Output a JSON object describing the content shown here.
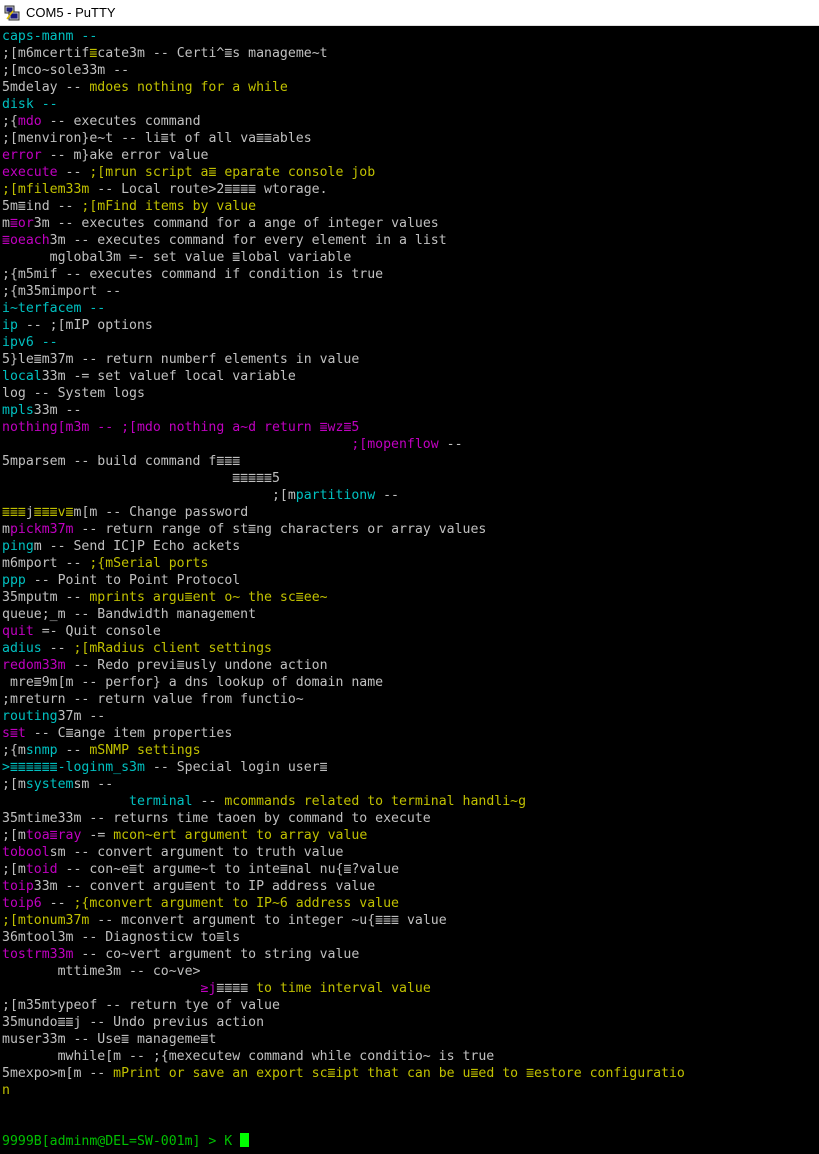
{
  "window": {
    "title": "COM5 - PuTTY",
    "icon": "putty-terminal-icon"
  },
  "colors": {
    "gray": "#c0c0c0",
    "cyan": "#00c0c0",
    "yellow": "#c0c000",
    "magenta": "#c000c0",
    "green": "#00c000",
    "cursor": "#00ff00"
  },
  "lines": [
    [
      [
        "cyan",
        "caps-manm --"
      ]
    ],
    [
      [
        "gray",
        ";[m6mcertif"
      ],
      [
        "yellow",
        "≣"
      ],
      [
        "gray",
        "cate3m -- Certi^"
      ],
      [
        "gray",
        "≣"
      ],
      [
        "gray",
        "s manageme~t"
      ]
    ],
    [
      [
        "gray",
        ";[mco~sole33m --"
      ]
    ],
    [
      [
        "gray",
        "5mdelay -- "
      ],
      [
        "yellow",
        "mdoes nothing for a while"
      ]
    ],
    [
      [
        "cyan",
        "disk --"
      ]
    ],
    [
      [
        "gray",
        ";{"
      ],
      [
        "magenta",
        "mdo"
      ],
      [
        "gray",
        " -- executes command"
      ]
    ],
    [
      [
        "gray",
        ";[menviron}e~t -- li"
      ],
      [
        "gray",
        "≣"
      ],
      [
        "gray",
        "t of all va"
      ],
      [
        "gray",
        "≣≣"
      ],
      [
        "gray",
        "ables"
      ]
    ],
    [
      [
        "magenta",
        "error"
      ],
      [
        "gray",
        " -- m}ake error value"
      ]
    ],
    [
      [
        "magenta",
        "execute"
      ],
      [
        "gray",
        " -- "
      ],
      [
        "yellow",
        ";[mrun script a"
      ],
      [
        "yellow",
        "≣"
      ],
      [
        "yellow",
        " eparate console job"
      ]
    ],
    [
      [
        "yellow",
        ";[mfilem33m"
      ],
      [
        "gray",
        " -- Local route>2"
      ],
      [
        "gray",
        "≣≣≣≣"
      ],
      [
        "gray",
        " wtorage."
      ]
    ],
    [
      [
        "gray",
        "5m"
      ],
      [
        "gray",
        "≣"
      ],
      [
        "gray",
        "ind -- "
      ],
      [
        "yellow",
        ";[mFind items by value"
      ]
    ],
    [
      [
        "gray",
        "m"
      ],
      [
        "magenta",
        "≣"
      ],
      [
        "magenta",
        "or"
      ],
      [
        "gray",
        "3m -- executes command for a ange of integer values"
      ]
    ],
    [
      [
        "magenta",
        "≣"
      ],
      [
        "magenta",
        "oeach"
      ],
      [
        "gray",
        "3m -- executes command for every element in a list"
      ]
    ],
    [
      [
        "gray",
        "      mglobal3m =- set value "
      ],
      [
        "gray",
        "≣"
      ],
      [
        "gray",
        "lobal variable"
      ]
    ],
    [
      [
        "gray",
        ";{m5mif -- executes command if condition is true"
      ]
    ],
    [
      [
        "gray",
        ";{m35mimport --"
      ]
    ],
    [
      [
        "cyan",
        "i~terfacem --"
      ]
    ],
    [
      [
        "cyan",
        "ip"
      ],
      [
        "gray",
        " -- ;[mIP options"
      ]
    ],
    [
      [
        "cyan",
        "ipv6 --"
      ]
    ],
    [
      [
        "gray",
        "5}le"
      ],
      [
        "gray",
        "≣"
      ],
      [
        "gray",
        "m37m -- return numberf elements in value"
      ]
    ],
    [
      [
        "cyan",
        "local"
      ],
      [
        "gray",
        "33m -= set valuef local variable"
      ]
    ],
    [
      [
        "gray",
        "log -- System logs"
      ]
    ],
    [
      [
        "cyan",
        "mpls"
      ],
      [
        "gray",
        "33m --"
      ]
    ],
    [
      [
        "magenta",
        "nothing[m3m -- ;[mdo nothing a~d return "
      ],
      [
        "magenta",
        "≣"
      ],
      [
        "magenta",
        "wz"
      ],
      [
        "magenta",
        "≣"
      ],
      [
        "magenta",
        "5"
      ]
    ],
    [
      [
        "magenta",
        "                                            ;[mopenflow"
      ],
      [
        "gray",
        " --"
      ]
    ],
    [
      [
        "gray",
        "5mparsem -- build command f"
      ],
      [
        "gray",
        "≣≣≣"
      ]
    ],
    [
      [
        "gray",
        "                             ≣≣≣≣≣5"
      ]
    ],
    [
      [
        "gray",
        "                                  ;[m"
      ],
      [
        "cyan",
        "partitionw"
      ],
      [
        "gray",
        " --"
      ]
    ],
    [
      [
        "yellow",
        "≣≣≣"
      ],
      [
        "gray",
        "j"
      ],
      [
        "yellow",
        "≣≣≣"
      ],
      [
        "yellow",
        "v≣"
      ],
      [
        "gray",
        "m[m -- Change password"
      ]
    ],
    [
      [
        "gray",
        "m"
      ],
      [
        "magenta",
        "pickm37m"
      ],
      [
        "gray",
        " -- return range of st"
      ],
      [
        "gray",
        "≣"
      ],
      [
        "gray",
        "ng characters or array values"
      ]
    ],
    [
      [
        "cyan",
        "ping"
      ],
      [
        "gray",
        "m -- Send IC]P Echo ackets"
      ]
    ],
    [
      [
        "gray",
        "m6mport -- "
      ],
      [
        "yellow",
        ";{mSerial ports"
      ]
    ],
    [
      [
        "cyan",
        "ppp"
      ],
      [
        "gray",
        " -- Point to Point Protocol"
      ]
    ],
    [
      [
        "gray",
        "35mputm -- "
      ],
      [
        "yellow",
        "mprints argu"
      ],
      [
        "yellow",
        "≣"
      ],
      [
        "yellow",
        "ent o~ the sc"
      ],
      [
        "yellow",
        "≣"
      ],
      [
        "yellow",
        "ee~"
      ]
    ],
    [
      [
        "gray",
        "queue;_m -- Bandwidth management"
      ]
    ],
    [
      [
        "magenta",
        "quit"
      ],
      [
        "gray",
        " =- Quit console"
      ]
    ],
    [
      [
        "cyan",
        "adius"
      ],
      [
        "gray",
        " -- "
      ],
      [
        "yellow",
        ";[mRadius client settings"
      ]
    ],
    [
      [
        "magenta",
        "redom33m"
      ],
      [
        "gray",
        " -- Redo previ"
      ],
      [
        "gray",
        "≣"
      ],
      [
        "gray",
        "usly undone action"
      ]
    ],
    [
      [
        "gray",
        " mre"
      ],
      [
        "gray",
        "≣"
      ],
      [
        "gray",
        "9m[m -- perfor} a dns lookup of domain name"
      ]
    ],
    [
      [
        "gray",
        ";mreturn -- return value from functio~"
      ]
    ],
    [
      [
        "cyan",
        "routing"
      ],
      [
        "gray",
        "37m --"
      ]
    ],
    [
      [
        "magenta",
        "s"
      ],
      [
        "magenta",
        "≣"
      ],
      [
        "magenta",
        "t"
      ],
      [
        "gray",
        " -- C"
      ],
      [
        "gray",
        "≣"
      ],
      [
        "gray",
        "ange item properties"
      ]
    ],
    [
      [
        "gray",
        ";{m"
      ],
      [
        "cyan",
        "snmp"
      ],
      [
        "gray",
        " -- "
      ],
      [
        "yellow",
        "mSNMP settings"
      ]
    ],
    [
      [
        "cyan",
        ">"
      ],
      [
        "cyan",
        "≣≣≣≣≣≣"
      ],
      [
        "cyan",
        "-loginm_s3m"
      ],
      [
        "gray",
        " -- Special login user"
      ],
      [
        "gray",
        "≣"
      ]
    ],
    [
      [
        "gray",
        ";[m"
      ],
      [
        "cyan",
        "system"
      ],
      [
        "gray",
        "sm --"
      ]
    ],
    [
      [
        "cyan",
        "                terminal"
      ],
      [
        "gray",
        " -- "
      ],
      [
        "yellow",
        "mcommands related to terminal handli~g"
      ]
    ],
    [
      [
        "gray",
        "35mtime33m -- returns time taoen by command to execute"
      ]
    ],
    [
      [
        "gray",
        ";[m"
      ],
      [
        "magenta",
        "toa"
      ],
      [
        "magenta",
        "≣"
      ],
      [
        "magenta",
        "ray"
      ],
      [
        "gray",
        " -= "
      ],
      [
        "yellow",
        "mcon~ert argument to array value"
      ]
    ],
    [
      [
        "magenta",
        "tobool"
      ],
      [
        "gray",
        "sm -- convert argument to truth value"
      ]
    ],
    [
      [
        "gray",
        ";[m"
      ],
      [
        "magenta",
        "toid"
      ],
      [
        "gray",
        " -- con~e"
      ],
      [
        "gray",
        "≣"
      ],
      [
        "gray",
        "t argume~t to inte"
      ],
      [
        "gray",
        "≣"
      ],
      [
        "gray",
        "nal nu{"
      ],
      [
        "gray",
        "≣"
      ],
      [
        "gray",
        "?value"
      ]
    ],
    [
      [
        "magenta",
        "toip"
      ],
      [
        "gray",
        "33m -- convert argu"
      ],
      [
        "gray",
        "≣"
      ],
      [
        "gray",
        "ent to IP address value"
      ]
    ],
    [
      [
        "magenta",
        "toip6"
      ],
      [
        "gray",
        " -- "
      ],
      [
        "yellow",
        ";{mconvert argument to IP~6 address value"
      ]
    ],
    [
      [
        "yellow",
        ";[mtonum37m"
      ],
      [
        "gray",
        " -- mconvert argument to integer ~u{"
      ],
      [
        "gray",
        "≣≣≣"
      ],
      [
        "gray",
        " value"
      ]
    ],
    [
      [
        "gray",
        "36mtool3m -- Diagnosticw to"
      ],
      [
        "gray",
        "≣"
      ],
      [
        "gray",
        "ls"
      ]
    ],
    [
      [
        "magenta",
        "tostrm33m"
      ],
      [
        "gray",
        " -- co~vert argument to string value"
      ]
    ],
    [
      [
        "gray",
        "       mttime3m -- co~ve>"
      ]
    ],
    [
      [
        "gray",
        "                         "
      ],
      [
        "magenta",
        "≥j"
      ],
      [
        "gray",
        "≣≣≣≣"
      ],
      [
        "yellow",
        " to time interval value"
      ]
    ],
    [
      [
        "gray",
        ";[m35mtypeof -- return tye of value"
      ]
    ],
    [
      [
        "gray",
        "35mundo"
      ],
      [
        "gray",
        "≣≣"
      ],
      [
        "gray",
        "j -- Undo previus action"
      ]
    ],
    [
      [
        "gray",
        "muser33m -- Use"
      ],
      [
        "gray",
        "≣"
      ],
      [
        "gray",
        " manageme"
      ],
      [
        "gray",
        "≣"
      ],
      [
        "gray",
        "t"
      ]
    ],
    [
      [
        "gray",
        "       mwhile[m -- ;{mexecutew command while conditio~ is true"
      ]
    ],
    [
      [
        "gray",
        "5mexpo>m[m -- "
      ],
      [
        "yellow",
        "mPrint or save an export sc"
      ],
      [
        "yellow",
        "≣"
      ],
      [
        "yellow",
        "ipt that can be u"
      ],
      [
        "yellow",
        "≣"
      ],
      [
        "yellow",
        "ed to "
      ],
      [
        "yellow",
        "≣"
      ],
      [
        "yellow",
        "estore configuratio"
      ]
    ],
    [
      [
        "yellow",
        "n"
      ]
    ],
    [],
    [],
    [
      [
        "green",
        "9999B[adminm@DEL=SW-001m] > K "
      ]
    ]
  ]
}
